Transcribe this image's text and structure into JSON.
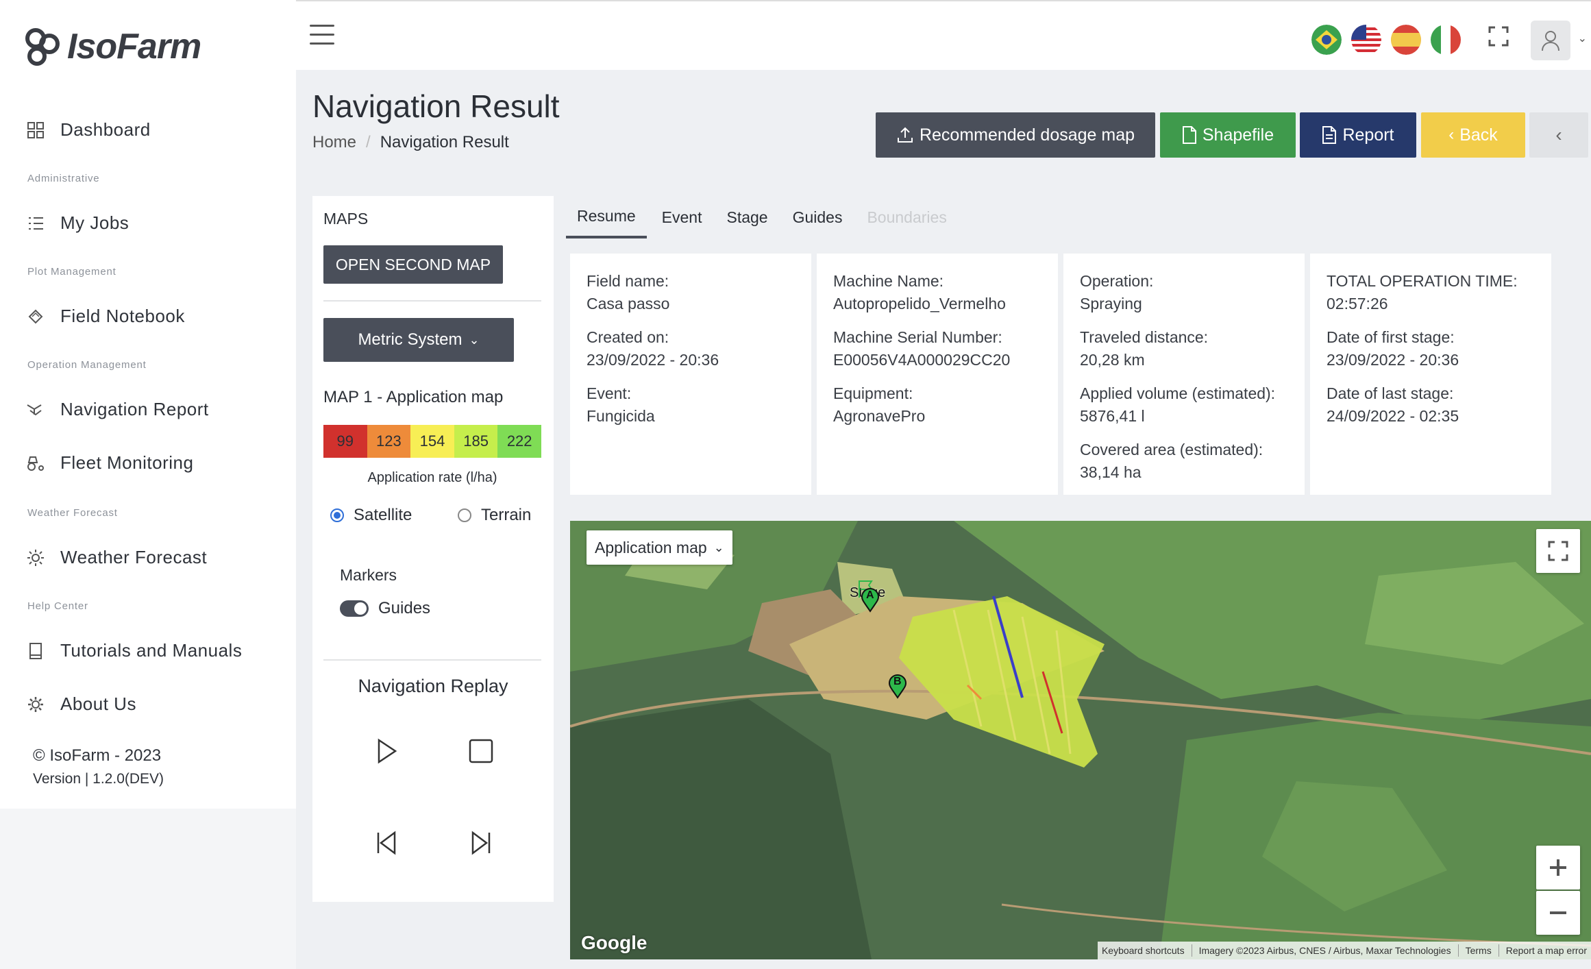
{
  "app": {
    "brand": "IsoFarm"
  },
  "sidebar": {
    "items": [
      {
        "label": "Dashboard",
        "icon": "grid-icon"
      },
      {
        "label": "My Jobs",
        "icon": "list-icon"
      },
      {
        "label": "Field Notebook",
        "icon": "notebook-icon"
      },
      {
        "label": "Navigation Report",
        "icon": "drone-icon"
      },
      {
        "label": "Fleet Monitoring",
        "icon": "tractor-icon"
      },
      {
        "label": "Weather Forecast",
        "icon": "sun-icon"
      },
      {
        "label": "Tutorials and Manuals",
        "icon": "book-icon"
      },
      {
        "label": "About Us",
        "icon": "gear-icon"
      }
    ],
    "sections": [
      "Administrative",
      "Plot Management",
      "Operation Management",
      "Weather Forecast",
      "Help Center"
    ],
    "copyright": "© IsoFarm - 2023",
    "version": "Version | 1.2.0(DEV)"
  },
  "header": {
    "title": "Navigation Result",
    "breadcrumb": [
      "Home",
      "Navigation Result"
    ],
    "buttons": {
      "dosage": "Recommended dosage map",
      "shapefile": "Shapefile",
      "report": "Report",
      "back": "Back"
    },
    "colors": {
      "dosage": "#4a4f5a",
      "shapefile": "#3f9a4c",
      "report": "#26396b",
      "back": "#f2cd4a"
    }
  },
  "maps_panel": {
    "title": "MAPS",
    "open_second": "OPEN SECOND MAP",
    "metric": "Metric System",
    "map1_title": "MAP 1 - Application map",
    "legend": [
      {
        "value": "99",
        "color": "#d1312d"
      },
      {
        "value": "123",
        "color": "#ee8b3a"
      },
      {
        "value": "154",
        "color": "#f7ee55"
      },
      {
        "value": "185",
        "color": "#c5ee4c"
      },
      {
        "value": "222",
        "color": "#7fdc55"
      }
    ],
    "legend_caption": "Application rate (l/ha)",
    "satellite": "Satellite",
    "terrain": "Terrain",
    "markers_title": "Markers",
    "guides": "Guides",
    "replay_title": "Navigation Replay"
  },
  "tabs": [
    "Resume",
    "Event",
    "Stage",
    "Guides",
    "Boundaries"
  ],
  "cards": [
    [
      {
        "label": "Field name:",
        "value": "Casa passo"
      },
      {
        "label": "Created on:",
        "value": "23/09/2022 - 20:36"
      },
      {
        "label": "Event:",
        "value": "Fungicida"
      }
    ],
    [
      {
        "label": "Machine Name:",
        "value": "Autopropelido_Vermelho"
      },
      {
        "label": "Machine Serial Number:",
        "value": "E00056V4A000029CC20"
      },
      {
        "label": "Equipment:",
        "value": "AgronavePro"
      }
    ],
    [
      {
        "label": "Operation:",
        "value": "Spraying"
      },
      {
        "label": "Traveled distance:",
        "value": "20,28 km"
      },
      {
        "label": "Applied volume (estimated):",
        "value": "5876,41 l"
      },
      {
        "label": "Covered area (estimated):",
        "value": "38,14 ha"
      }
    ],
    [
      {
        "label": "TOTAL OPERATION TIME:",
        "value": "02:57:26"
      },
      {
        "label": "Date of first stage:",
        "value": "23/09/2022 - 20:36"
      },
      {
        "label": "Date of last stage:",
        "value": "24/09/2022 - 02:35"
      }
    ]
  ],
  "map": {
    "select": "Application map",
    "stage_label": "Stage",
    "marker_a": "A",
    "marker_b": "B",
    "google": "Google",
    "attribution": [
      "Keyboard shortcuts",
      "Imagery ©2023 Airbus, CNES / Airbus, Maxar Technologies",
      "Terms",
      "Report a map error"
    ]
  }
}
